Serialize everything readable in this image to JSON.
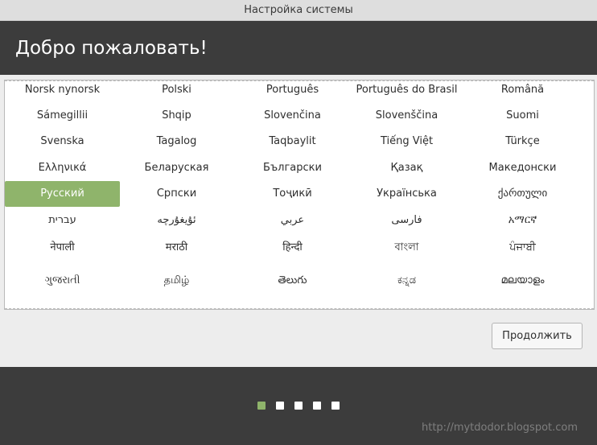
{
  "window": {
    "title": "Настройка системы"
  },
  "header": {
    "title": "Добро пожаловать!"
  },
  "languages": [
    [
      "Norsk nynorsk",
      "Polski",
      "Português",
      "Português do Brasil",
      "Română"
    ],
    [
      "Sámegillii",
      "Shqip",
      "Slovenčina",
      "Slovenščina",
      "Suomi"
    ],
    [
      "Svenska",
      "Tagalog",
      "Taqbaylit",
      "Tiếng Việt",
      "Türkçe"
    ],
    [
      "Ελληνικά",
      "Беларуская",
      "Български",
      "Қазақ",
      "Македонски"
    ],
    [
      "Русский",
      "Српски",
      "Тоҷикӣ",
      "Українська",
      "ქართული"
    ],
    [
      "עברית",
      "ئۇيغۇرچە",
      "عربي",
      "فارسی",
      "አማርኛ"
    ],
    [
      "नेपाली",
      "मराठी",
      "हिन्दी",
      "বাংলা",
      "ਪੰਜਾਬੀ"
    ],
    [
      "ગુજરાતી",
      "தமிழ்",
      "తెలుగు",
      "ಕನ್ನಡ",
      "മലയാളം"
    ]
  ],
  "selected_language": "Русский",
  "buttons": {
    "continue_label": "Продолжить"
  },
  "pagination": {
    "pages": 5,
    "current": 1
  },
  "colors": {
    "accent": "#8fb46b",
    "header_bg": "#3c3c3c",
    "content_bg": "#ededed"
  },
  "watermark": "http://mytdodor.blogspot.com"
}
